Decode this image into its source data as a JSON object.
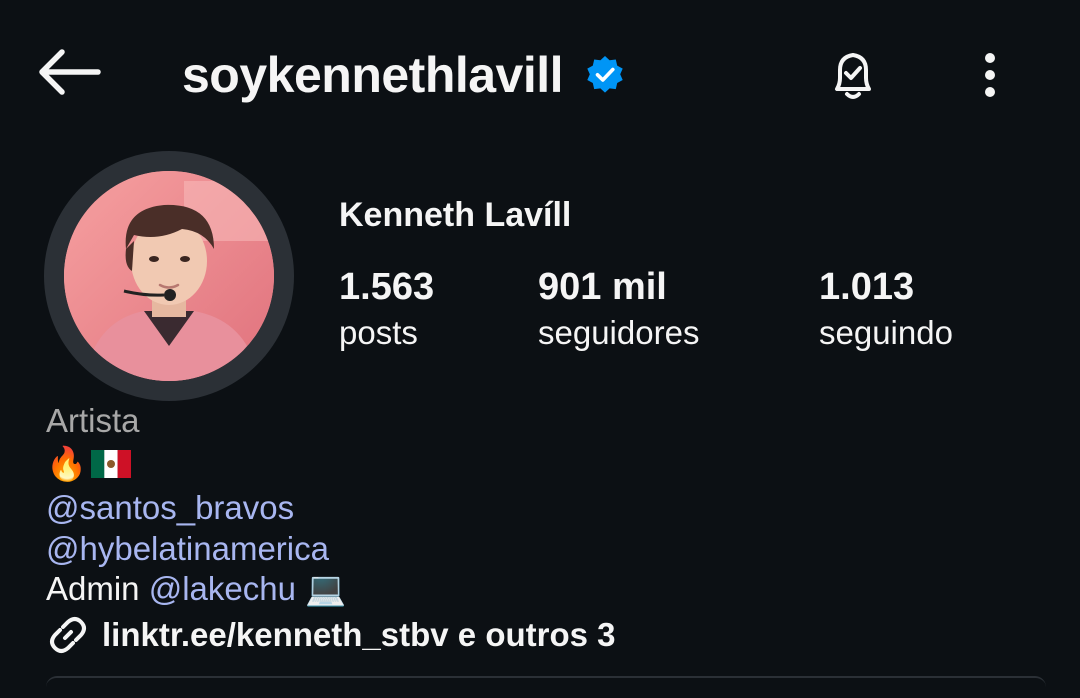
{
  "header": {
    "username": "soykenneth​lavill",
    "icons": {
      "back": "back-arrow-icon",
      "verified": "verified-badge-icon",
      "notifications": "bell-check-icon",
      "more": "more-vertical-icon"
    }
  },
  "profile": {
    "display_name": "Kenneth Lavíll",
    "stats": {
      "posts": {
        "value": "1.563",
        "label": "posts"
      },
      "followers": {
        "value": "901 mil",
        "label": "seguidores"
      },
      "following": {
        "value": "1.013",
        "label": "seguindo"
      }
    }
  },
  "bio": {
    "category": "Artista",
    "emoji": "🔥",
    "mentions": [
      "santos_bravos",
      "hybelatinamerica"
    ],
    "admin_prefix": "Admin",
    "admin_mention": "lakechu",
    "admin_emoji": "💻",
    "link": "linktr.ee/kenneth_stbv e outros 3"
  },
  "colors": {
    "background": "#0c1014",
    "text": "#f5f5f5",
    "muted": "#a8a8a8",
    "mention": "#a8b6f0",
    "verified": "#0095f6"
  }
}
